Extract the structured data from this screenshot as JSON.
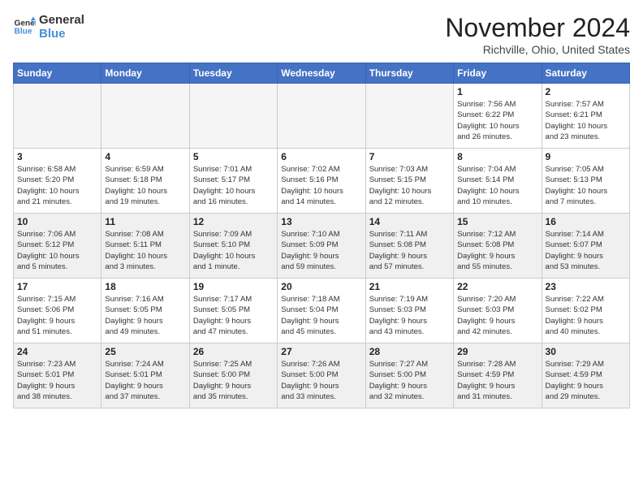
{
  "logo": {
    "line1": "General",
    "line2": "Blue"
  },
  "title": "November 2024",
  "location": "Richville, Ohio, United States",
  "weekdays": [
    "Sunday",
    "Monday",
    "Tuesday",
    "Wednesday",
    "Thursday",
    "Friday",
    "Saturday"
  ],
  "weeks": [
    [
      {
        "day": "",
        "empty": true
      },
      {
        "day": "",
        "empty": true
      },
      {
        "day": "",
        "empty": true
      },
      {
        "day": "",
        "empty": true
      },
      {
        "day": "",
        "empty": true
      },
      {
        "day": "1",
        "info": "Sunrise: 7:56 AM\nSunset: 6:22 PM\nDaylight: 10 hours\nand 26 minutes."
      },
      {
        "day": "2",
        "info": "Sunrise: 7:57 AM\nSunset: 6:21 PM\nDaylight: 10 hours\nand 23 minutes."
      }
    ],
    [
      {
        "day": "3",
        "info": "Sunrise: 6:58 AM\nSunset: 5:20 PM\nDaylight: 10 hours\nand 21 minutes."
      },
      {
        "day": "4",
        "info": "Sunrise: 6:59 AM\nSunset: 5:18 PM\nDaylight: 10 hours\nand 19 minutes."
      },
      {
        "day": "5",
        "info": "Sunrise: 7:01 AM\nSunset: 5:17 PM\nDaylight: 10 hours\nand 16 minutes."
      },
      {
        "day": "6",
        "info": "Sunrise: 7:02 AM\nSunset: 5:16 PM\nDaylight: 10 hours\nand 14 minutes."
      },
      {
        "day": "7",
        "info": "Sunrise: 7:03 AM\nSunset: 5:15 PM\nDaylight: 10 hours\nand 12 minutes."
      },
      {
        "day": "8",
        "info": "Sunrise: 7:04 AM\nSunset: 5:14 PM\nDaylight: 10 hours\nand 10 minutes."
      },
      {
        "day": "9",
        "info": "Sunrise: 7:05 AM\nSunset: 5:13 PM\nDaylight: 10 hours\nand 7 minutes."
      }
    ],
    [
      {
        "day": "10",
        "info": "Sunrise: 7:06 AM\nSunset: 5:12 PM\nDaylight: 10 hours\nand 5 minutes."
      },
      {
        "day": "11",
        "info": "Sunrise: 7:08 AM\nSunset: 5:11 PM\nDaylight: 10 hours\nand 3 minutes."
      },
      {
        "day": "12",
        "info": "Sunrise: 7:09 AM\nSunset: 5:10 PM\nDaylight: 10 hours\nand 1 minute."
      },
      {
        "day": "13",
        "info": "Sunrise: 7:10 AM\nSunset: 5:09 PM\nDaylight: 9 hours\nand 59 minutes."
      },
      {
        "day": "14",
        "info": "Sunrise: 7:11 AM\nSunset: 5:08 PM\nDaylight: 9 hours\nand 57 minutes."
      },
      {
        "day": "15",
        "info": "Sunrise: 7:12 AM\nSunset: 5:08 PM\nDaylight: 9 hours\nand 55 minutes."
      },
      {
        "day": "16",
        "info": "Sunrise: 7:14 AM\nSunset: 5:07 PM\nDaylight: 9 hours\nand 53 minutes."
      }
    ],
    [
      {
        "day": "17",
        "info": "Sunrise: 7:15 AM\nSunset: 5:06 PM\nDaylight: 9 hours\nand 51 minutes."
      },
      {
        "day": "18",
        "info": "Sunrise: 7:16 AM\nSunset: 5:05 PM\nDaylight: 9 hours\nand 49 minutes."
      },
      {
        "day": "19",
        "info": "Sunrise: 7:17 AM\nSunset: 5:05 PM\nDaylight: 9 hours\nand 47 minutes."
      },
      {
        "day": "20",
        "info": "Sunrise: 7:18 AM\nSunset: 5:04 PM\nDaylight: 9 hours\nand 45 minutes."
      },
      {
        "day": "21",
        "info": "Sunrise: 7:19 AM\nSunset: 5:03 PM\nDaylight: 9 hours\nand 43 minutes."
      },
      {
        "day": "22",
        "info": "Sunrise: 7:20 AM\nSunset: 5:03 PM\nDaylight: 9 hours\nand 42 minutes."
      },
      {
        "day": "23",
        "info": "Sunrise: 7:22 AM\nSunset: 5:02 PM\nDaylight: 9 hours\nand 40 minutes."
      }
    ],
    [
      {
        "day": "24",
        "info": "Sunrise: 7:23 AM\nSunset: 5:01 PM\nDaylight: 9 hours\nand 38 minutes."
      },
      {
        "day": "25",
        "info": "Sunrise: 7:24 AM\nSunset: 5:01 PM\nDaylight: 9 hours\nand 37 minutes."
      },
      {
        "day": "26",
        "info": "Sunrise: 7:25 AM\nSunset: 5:00 PM\nDaylight: 9 hours\nand 35 minutes."
      },
      {
        "day": "27",
        "info": "Sunrise: 7:26 AM\nSunset: 5:00 PM\nDaylight: 9 hours\nand 33 minutes."
      },
      {
        "day": "28",
        "info": "Sunrise: 7:27 AM\nSunset: 5:00 PM\nDaylight: 9 hours\nand 32 minutes."
      },
      {
        "day": "29",
        "info": "Sunrise: 7:28 AM\nSunset: 4:59 PM\nDaylight: 9 hours\nand 31 minutes."
      },
      {
        "day": "30",
        "info": "Sunrise: 7:29 AM\nSunset: 4:59 PM\nDaylight: 9 hours\nand 29 minutes."
      }
    ]
  ]
}
